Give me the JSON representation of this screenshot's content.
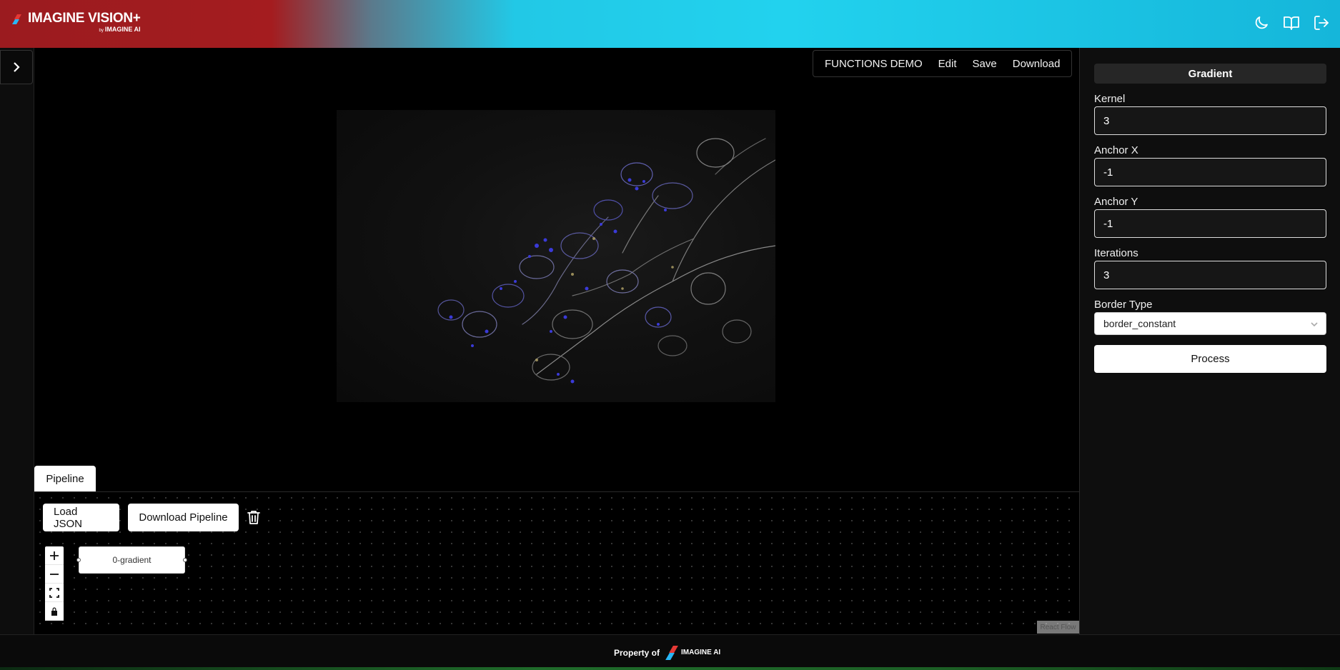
{
  "header": {
    "brand_title": "IMAGINE VISION+",
    "brand_by": "by",
    "brand_company": "IMAGINE AI",
    "icons": [
      "moon-icon",
      "book-icon",
      "logout-icon"
    ]
  },
  "topmenu": {
    "items": [
      "FUNCTIONS DEMO",
      "Edit",
      "Save",
      "Download"
    ]
  },
  "pipeline": {
    "tab_label": "Pipeline",
    "load_json": "Load JSON",
    "download_pipeline": "Download Pipeline",
    "node_label": "0-gradient",
    "attribution": "React Flow"
  },
  "panel": {
    "title": "Gradient",
    "fields": [
      {
        "label": "Kernel",
        "value": "3"
      },
      {
        "label": "Anchor X",
        "value": "-1"
      },
      {
        "label": "Anchor Y",
        "value": "-1"
      },
      {
        "label": "Iterations",
        "value": "3"
      }
    ],
    "border_type_label": "Border Type",
    "border_type_value": "border_constant",
    "process_label": "Process"
  },
  "footer": {
    "property_of": "Property of",
    "company": "IMAGINE AI"
  },
  "colors": {
    "brand_red": "#a41c1f",
    "brand_cyan": "#22d2ee",
    "accent_green": "#1f6b2a"
  }
}
